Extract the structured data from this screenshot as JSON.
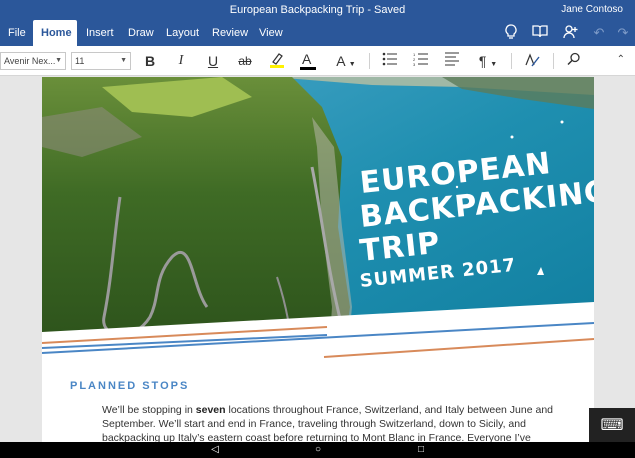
{
  "window": {
    "title": "European Backpacking Trip - Saved",
    "user": "Jane Contoso"
  },
  "ribbon": {
    "tabs": [
      {
        "label": "File"
      },
      {
        "label": "Home",
        "active": true
      },
      {
        "label": "Insert"
      },
      {
        "label": "Draw"
      },
      {
        "label": "Layout"
      },
      {
        "label": "Review"
      },
      {
        "label": "View"
      }
    ],
    "icons": [
      "lightbulb-icon",
      "book-icon",
      "share-person-icon",
      "undo-icon",
      "redo-icon"
    ]
  },
  "toolbar": {
    "font_name": "Avenir Nex...",
    "font_size": "11",
    "bold_label": "B",
    "italic_label": "I",
    "underline_label": "U",
    "strike_label": "ab",
    "font_color_label": "A",
    "font_size_label": "A",
    "colors": {
      "highlight": "#fff200",
      "font_color": "#000000"
    }
  },
  "document": {
    "cover": {
      "line1": "EUROPEAN",
      "line2": "BACKPACKING",
      "line3": "TRIP",
      "line4": "SUMMER 2017"
    },
    "section_title": "PLANNED STOPS",
    "paragraph": {
      "part1": "We’ll be stopping in ",
      "bold": "seven",
      "part2": " locations throughout France, Switzerland, and Italy between June and September. We’ll start and end in France, traveling through Switzerland, down to Sicily, and backpacking up Italy’s eastern coast before returning to Mont Blanc in France. Everyone I’ve"
    },
    "colors": {
      "accent_blue": "#4a86c5",
      "accent_orange": "#d88a5a",
      "brand": "#2b579a"
    }
  }
}
